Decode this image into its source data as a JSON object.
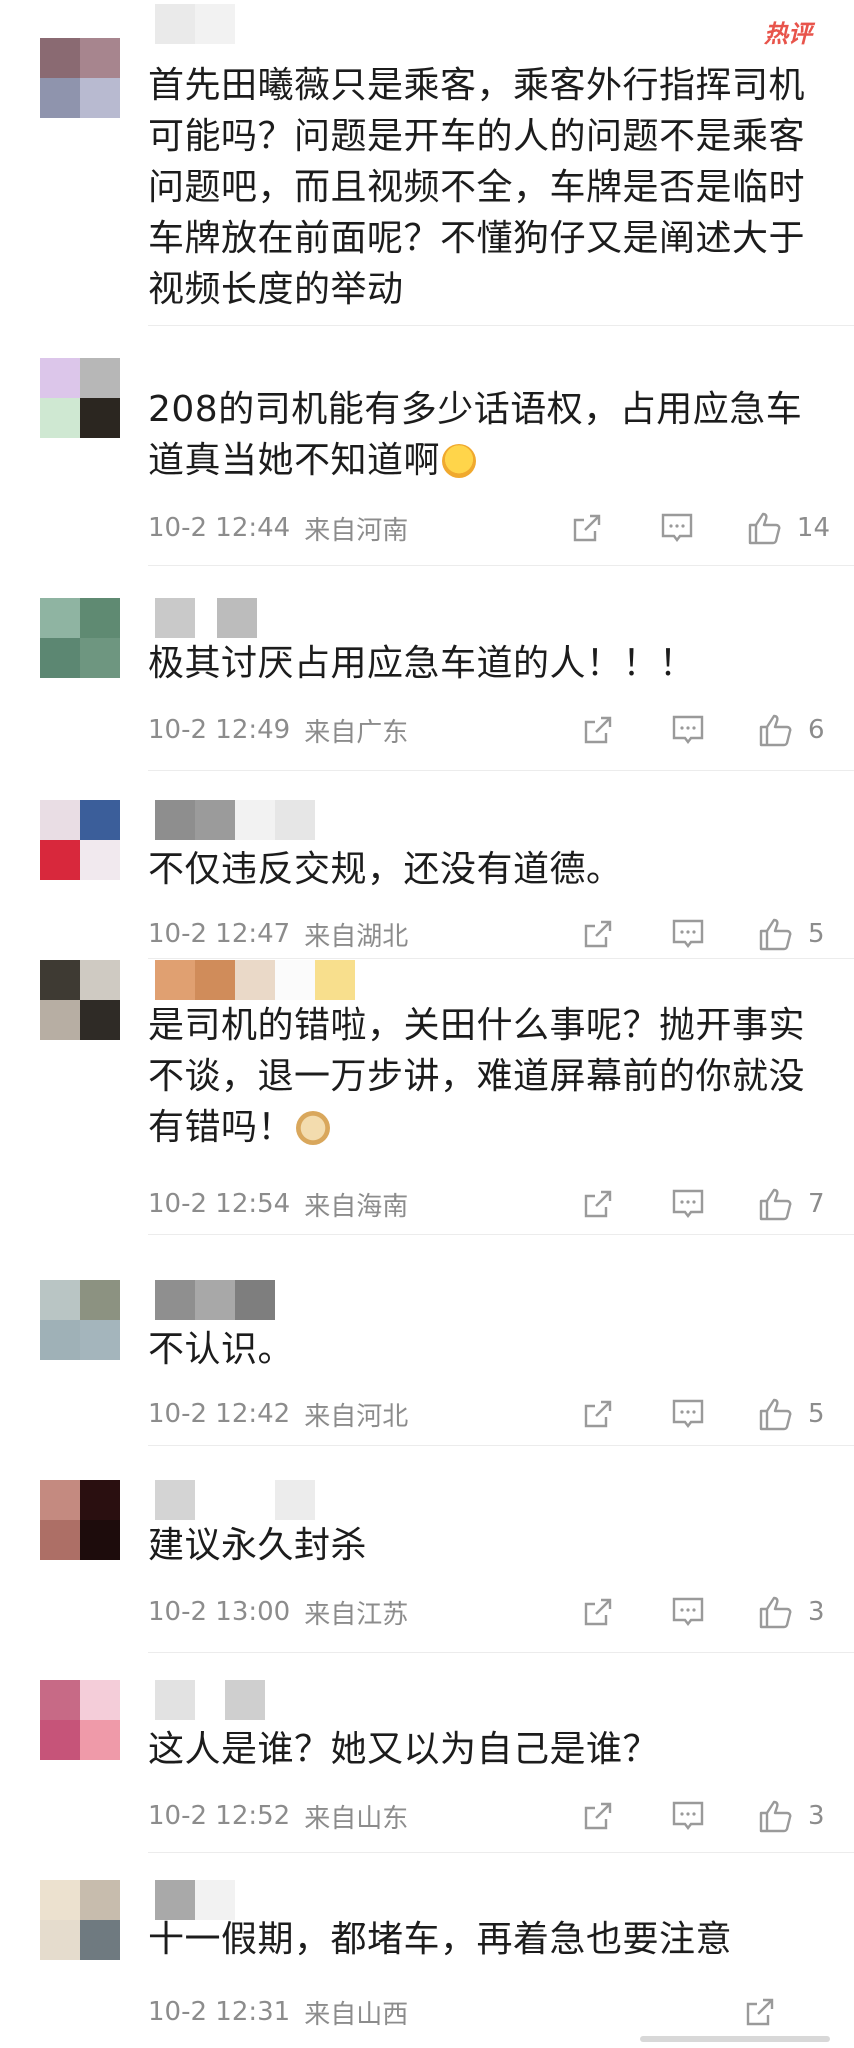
{
  "hot_label": "热评",
  "comments": [
    {
      "text": "首先田曦薇只是乘客，乘客外行指挥司机可能吗？问题是开车的人的问题不是乘客问题吧，而且视频不全，车牌是否是临时车牌放在前面呢？不懂狗仔又是阐述大于视频长度的举动",
      "avatar_colors": [
        "#8a6a72",
        "#a7858e",
        "#8f94ad",
        "#b8bad0"
      ]
    },
    {
      "text": "208的司机能有多少话语权，占用应急车道真当她不知道啊",
      "emoji": "laugh-cry-emoji",
      "time": "10-2 12:44",
      "location": "来自河南",
      "likes": "14",
      "avatar_colors": [
        "#dcc6ea",
        "#b7b7b7",
        "#cfe8d2",
        "#2b2620"
      ]
    },
    {
      "text": "极其讨厌占用应急车道的人！！！",
      "time": "10-2 12:49",
      "location": "来自广东",
      "likes": "6",
      "avatar_colors": [
        "#8fb4a2",
        "#5f8a72",
        "#5c8772",
        "#6e9680"
      ]
    },
    {
      "text": "不仅违反交规，还没有道德。",
      "time": "10-2 12:47",
      "location": "来自湖北",
      "likes": "5",
      "avatar_colors": [
        "#e9dde4",
        "#3b5e9a",
        "#d8283c",
        "#f1e9ee"
      ]
    },
    {
      "text": "是司机的错啦，关田什么事呢？抛开事实不谈，退一万步讲，难道屏幕前的你就没有错吗！",
      "emoji": "doge-emoji",
      "time": "10-2 12:54",
      "location": "来自海南",
      "likes": "7",
      "avatar_colors": [
        "#3e3a33",
        "#cfcac2",
        "#b7aea3",
        "#2f2b26"
      ]
    },
    {
      "text": "不认识。",
      "time": "10-2 12:42",
      "location": "来自河北",
      "likes": "5",
      "avatar_colors": [
        "#b9c5c4",
        "#8c9281",
        "#9fb1b7",
        "#a4b5bc"
      ]
    },
    {
      "text": "建议永久封杀",
      "time": "10-2 13:00",
      "location": "来自江苏",
      "likes": "3",
      "avatar_colors": [
        "#c48a80",
        "#2a0f10",
        "#ad6f66",
        "#1d0c0c"
      ]
    },
    {
      "text": "这人是谁？她又以为自己是谁？",
      "time": "10-2 12:52",
      "location": "来自山东",
      "likes": "3",
      "avatar_colors": [
        "#c76a86",
        "#f4cdd9",
        "#c65479",
        "#ef9aa9"
      ]
    },
    {
      "text": "十一假期，都堵车，再着急也要注意",
      "time": "10-2 12:31",
      "location": "来自山西",
      "likes": "",
      "avatar_colors": [
        "#ece1cf",
        "#c7bcad",
        "#e5dccd",
        "#6f7a80"
      ]
    }
  ]
}
